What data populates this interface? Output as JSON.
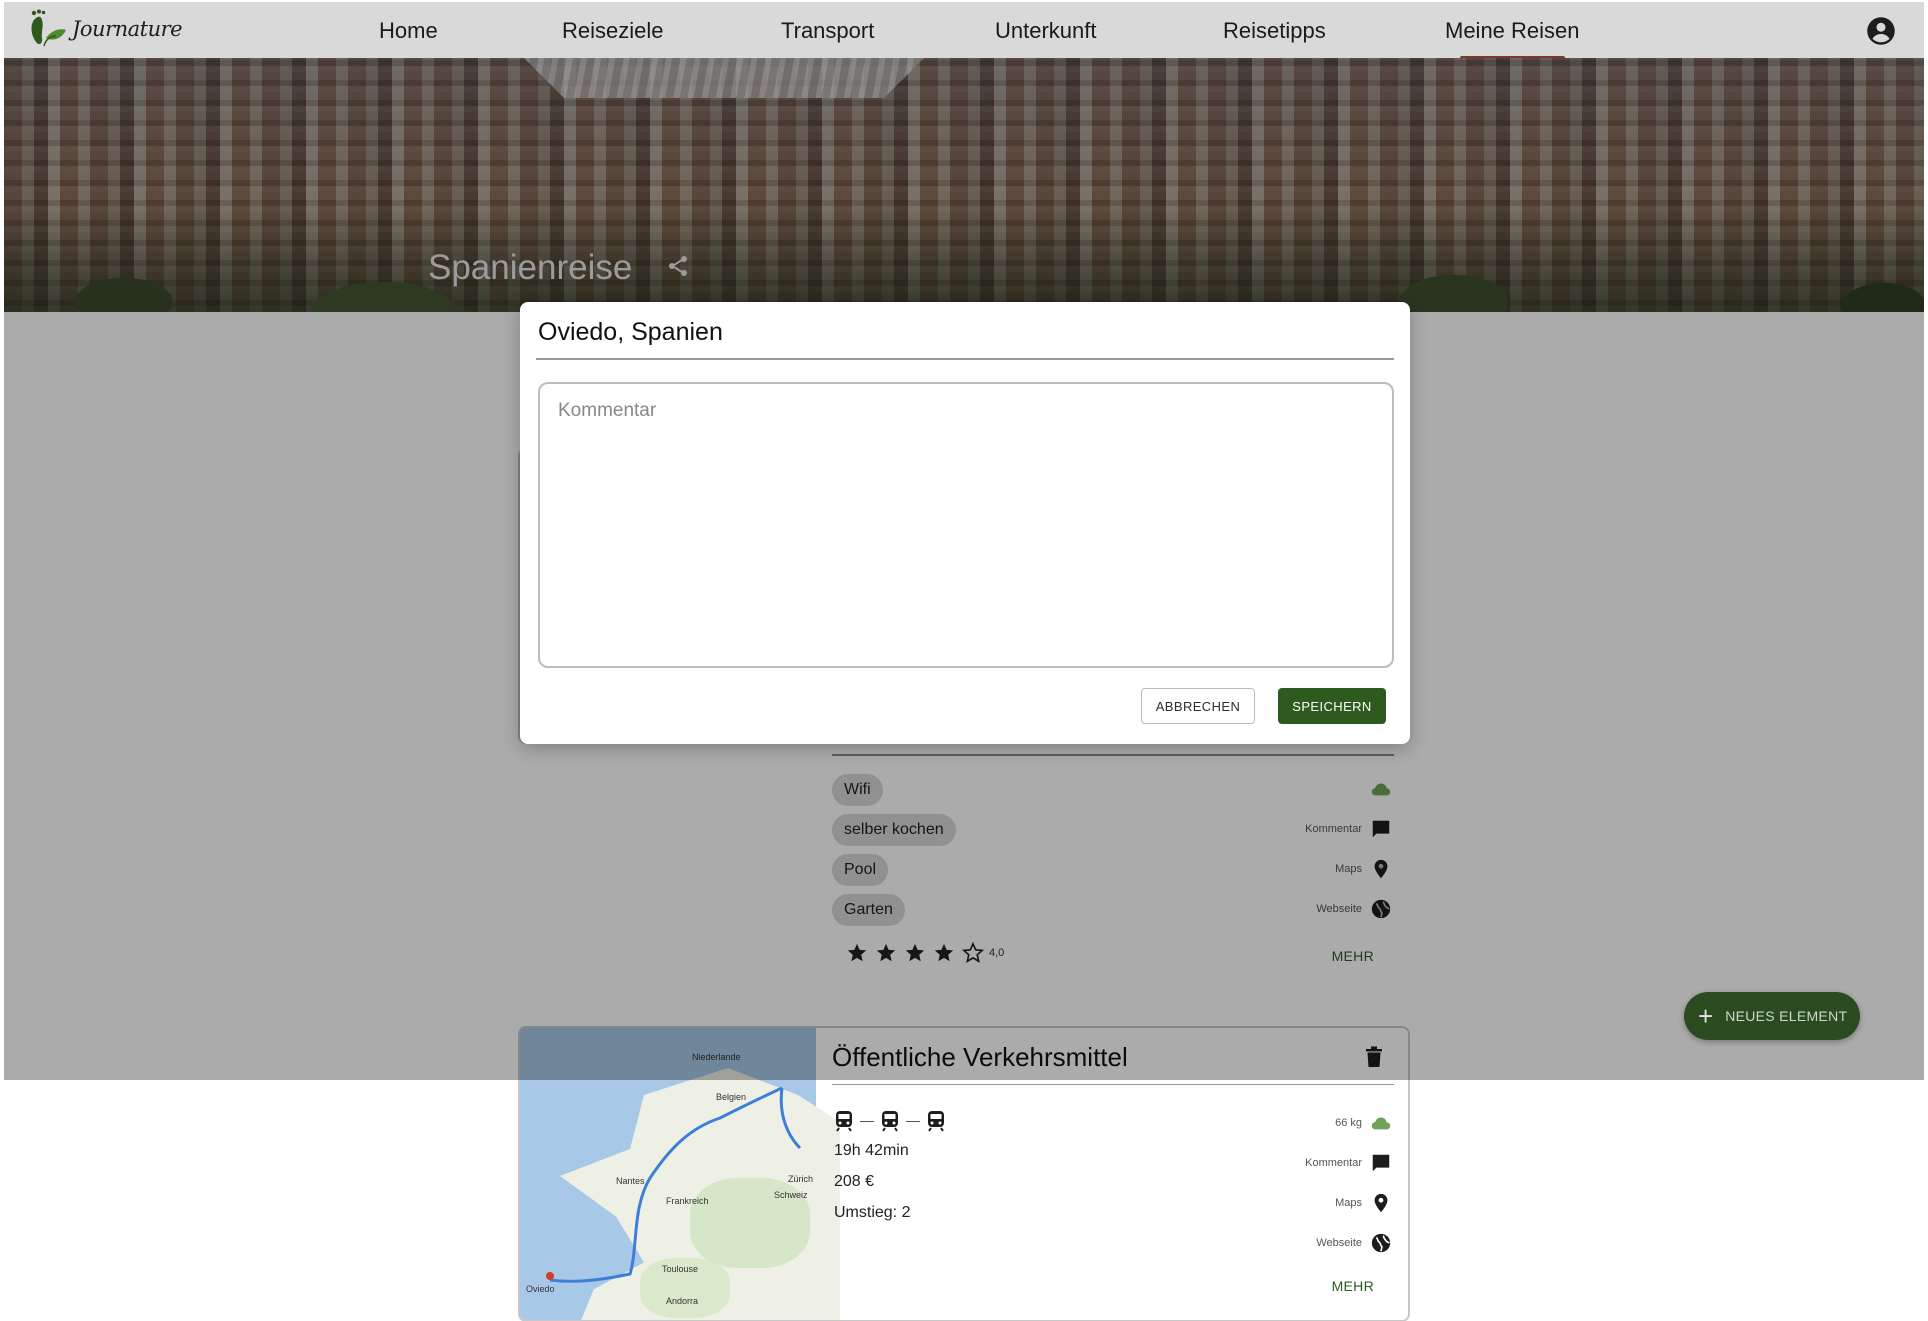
{
  "app": {
    "logo_text": "Journature"
  },
  "nav": {
    "items": [
      {
        "label": "Home"
      },
      {
        "label": "Reiseziele"
      },
      {
        "label": "Transport"
      },
      {
        "label": "Unterkunft"
      },
      {
        "label": "Reisetipps"
      },
      {
        "label": "Meine Reisen",
        "active": true
      }
    ],
    "account_icon": "account-circle-icon"
  },
  "hero": {
    "trip_title": "Spanienreise",
    "share_icon": "share-icon"
  },
  "dialog": {
    "title": "Oviedo, Spanien",
    "comment_placeholder": "Kommentar",
    "comment_value": "",
    "cancel_label": "ABBRECHEN",
    "save_label": "SPEICHERN"
  },
  "accommodation_card": {
    "chips": [
      "Wifi",
      "selber kochen",
      "Pool",
      "Garten"
    ],
    "side": {
      "comment_label": "Kommentar",
      "maps_label": "Maps",
      "website_label": "Webseite"
    },
    "rating": 4,
    "rating_text": "4,0",
    "more_label": "MEHR"
  },
  "transport_card": {
    "title": "Öffentliche Verkehrsmittel",
    "co2": "66 kg",
    "duration": "19h 42min",
    "price": "208 €",
    "transfers": "Umstieg: 2",
    "side": {
      "comment_label": "Kommentar",
      "maps_label": "Maps",
      "website_label": "Webseite"
    },
    "more_label": "MEHR",
    "map_labels": [
      "Niederlande",
      "Belgien",
      "Frankreich",
      "Schweiz",
      "Oviedo",
      "Toulouse",
      "Andorra",
      "Nantes",
      "Zürich"
    ]
  },
  "fab": {
    "label": "NEUES ELEMENT"
  },
  "colors": {
    "brand_green": "#2d5a1e",
    "nav_bg": "#d9d9d9",
    "active_indicator": "#7a3a2a",
    "cloud_green": "#6fa35a"
  }
}
